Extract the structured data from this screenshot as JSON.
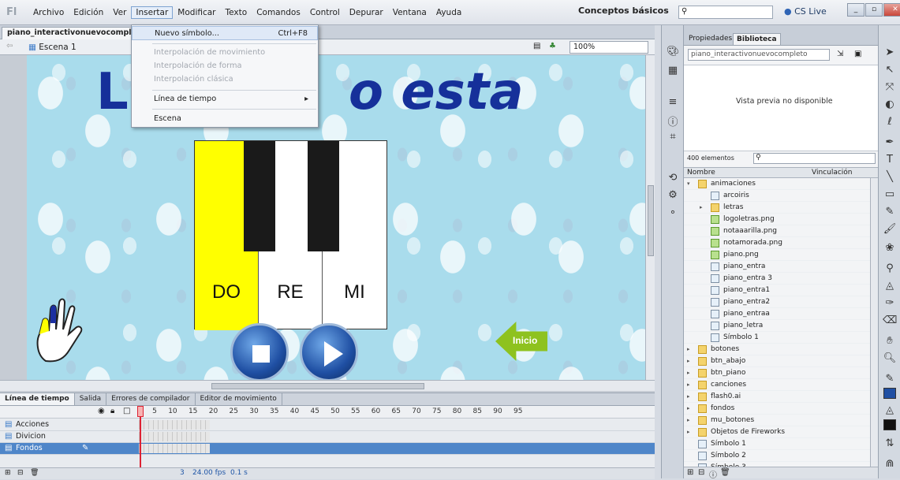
{
  "menubar": {
    "items": [
      "Archivo",
      "Edición",
      "Ver",
      "Insertar",
      "Modificar",
      "Texto",
      "Comandos",
      "Control",
      "Depurar",
      "Ventana",
      "Ayuda"
    ],
    "workspace": "Conceptos básicos",
    "cslive": "CS Live"
  },
  "document": {
    "tab": "piano_interactivonuevocompleto",
    "scene": "Escena 1",
    "zoom": "100%"
  },
  "insert_menu": {
    "new_symbol": "Nuevo símbolo...",
    "new_symbol_shortcut": "Ctrl+F8",
    "motion_tween": "Interpolación de movimiento",
    "shape_tween": "Interpolación de forma",
    "classic_tween": "Interpolación clásica",
    "timeline": "Línea de tiempo",
    "scene": "Escena"
  },
  "stage": {
    "title_left": "Ll",
    "title_right": "o esta",
    "keys": [
      "DO",
      "RE",
      "MI"
    ],
    "inicio": "Inicio",
    "highlight_color": "#ffff00",
    "title_color": "#16309a",
    "button_color": "#1f4fa3",
    "inicio_color": "#8ec21f"
  },
  "timeline": {
    "tabs": [
      "Línea de tiempo",
      "Salida",
      "Errores de compilador",
      "Editor de movimiento"
    ],
    "frame_numbers": "1    5     10     15     20     25     30     35     40     45     50     55     60     65     70     75     80     85     90     95",
    "layers": [
      "Acciones",
      "Divicion",
      "Fondos"
    ],
    "current_frame": "3",
    "fps": "24.00 fps",
    "time": "0.1 s"
  },
  "library": {
    "tabs": [
      "Propiedades",
      "Biblioteca"
    ],
    "document": "piano_interactivonuevocompleto",
    "preview": "Vista previa no disponible",
    "count": "400 elementos",
    "col_name": "Nombre",
    "col_link": "Vinculación",
    "items": [
      {
        "label": "animaciones",
        "type": "folder",
        "level": 0,
        "open": true
      },
      {
        "label": "arcoiris",
        "type": "movieclip",
        "level": 1
      },
      {
        "label": "letras",
        "type": "folder",
        "level": 1,
        "open": false
      },
      {
        "label": "logoletras.png",
        "type": "bitmap",
        "level": 1
      },
      {
        "label": "notaaarilla.png",
        "type": "bitmap",
        "level": 1
      },
      {
        "label": "notamorada.png",
        "type": "bitmap",
        "level": 1
      },
      {
        "label": "piano.png",
        "type": "bitmap",
        "level": 1
      },
      {
        "label": "piano_entra",
        "type": "movieclip",
        "level": 1
      },
      {
        "label": "piano_entra 3",
        "type": "movieclip",
        "level": 1
      },
      {
        "label": "piano_entra1",
        "type": "movieclip",
        "level": 1
      },
      {
        "label": "piano_entra2",
        "type": "movieclip",
        "level": 1
      },
      {
        "label": "piano_entraa",
        "type": "movieclip",
        "level": 1
      },
      {
        "label": "piano_letra",
        "type": "movieclip",
        "level": 1
      },
      {
        "label": "Símbolo 1",
        "type": "movieclip",
        "level": 1
      },
      {
        "label": "botones",
        "type": "folder",
        "level": 0
      },
      {
        "label": "btn_abajo",
        "type": "folder",
        "level": 0
      },
      {
        "label": "btn_piano",
        "type": "folder",
        "level": 0
      },
      {
        "label": "canciones",
        "type": "folder",
        "level": 0
      },
      {
        "label": "flash0.ai",
        "type": "folder",
        "level": 0
      },
      {
        "label": "fondos",
        "type": "folder",
        "level": 0
      },
      {
        "label": "mu_botones",
        "type": "folder",
        "level": 0
      },
      {
        "label": "Objetos de Fireworks",
        "type": "folder",
        "level": 0
      },
      {
        "label": "Símbolo 1",
        "type": "movieclip",
        "level": 0
      },
      {
        "label": "Símbolo 2",
        "type": "movieclip",
        "level": 0
      },
      {
        "label": "Símbolo 3",
        "type": "movieclip",
        "level": 0
      }
    ]
  }
}
